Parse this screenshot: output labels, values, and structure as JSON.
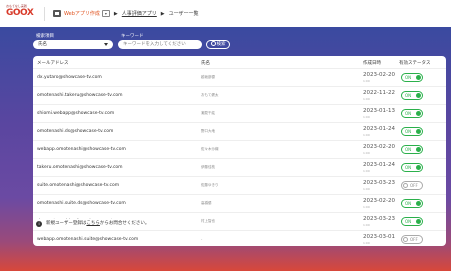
{
  "header": {
    "logo_tag": "おもてなし実践",
    "logo_mark": "GOOX",
    "app_name": "Webアプリ作成",
    "app_badge": "▾",
    "crumb_1": "人事評価アプリ",
    "crumb_2": "ユーザー一覧"
  },
  "filter": {
    "field_label": "検索項目",
    "field_value": "氏名",
    "keyword_label": "キーワード",
    "keyword_placeholder": "キーワードを入力してください",
    "search_label": "検索"
  },
  "table": {
    "columns": [
      "メールアドレス",
      "氏名",
      "作成日時",
      "有効ステータス"
    ],
    "rows": [
      {
        "email": "dx.yutaro@showcase-tv.com",
        "name": "越坂部優",
        "date": "2023-02-20",
        "time": "1:00",
        "status": "ON"
      },
      {
        "email": "omotenashi.takeru@showcase-tv.com",
        "name": "おもて健太",
        "date": "2022-11-22",
        "time": "1:00",
        "status": "ON"
      },
      {
        "email": "shiomi.webapp@showcase-tv.com",
        "name": "潮見千紘",
        "date": "2023-01-13",
        "time": "1:00",
        "status": "ON"
      },
      {
        "email": "omotenashi.ds@showcase-tv.com",
        "name": "野口大地",
        "date": "2023-01-24",
        "time": "1:00",
        "status": "ON"
      },
      {
        "email": "webapp.omotenashi@showcase-tv.com",
        "name": "佐々木沙織",
        "date": "2023-02-20",
        "time": "1:00",
        "status": "ON"
      },
      {
        "email": "takeru.omotenashi@showcase-tv.com",
        "name": "伊藤佳枝",
        "date": "2023-01-24",
        "time": "1:00",
        "status": "ON"
      },
      {
        "email": "suite.omotenashi@showcase-tv.com",
        "name": "佐藤ゆきり",
        "date": "2023-03-23",
        "time": "1:00",
        "status": "OFF"
      },
      {
        "email": "omotenashi.suite.ds@showcase-tv.com",
        "name": "高橋優",
        "date": "2023-02-20",
        "time": "1:00",
        "status": "ON"
      },
      {
        "email": "ds.omotenashi.suite@showcase-tv.com",
        "name": "村上智也",
        "date": "2023-03-23",
        "time": "1:00",
        "status": "ON"
      },
      {
        "email": "webapp.omotenashi.suite@showcase-tv.com",
        "name": "-",
        "date": "2023-03-01",
        "time": "1:00",
        "status": "OFF"
      }
    ]
  },
  "info": {
    "prefix": "新規ユーザー登録は",
    "link": "こちら",
    "suffix": "からお問合せください。"
  },
  "colors": {
    "accent": "#e0531f",
    "on": "#2bb04b",
    "off": "#aaaaaa"
  }
}
